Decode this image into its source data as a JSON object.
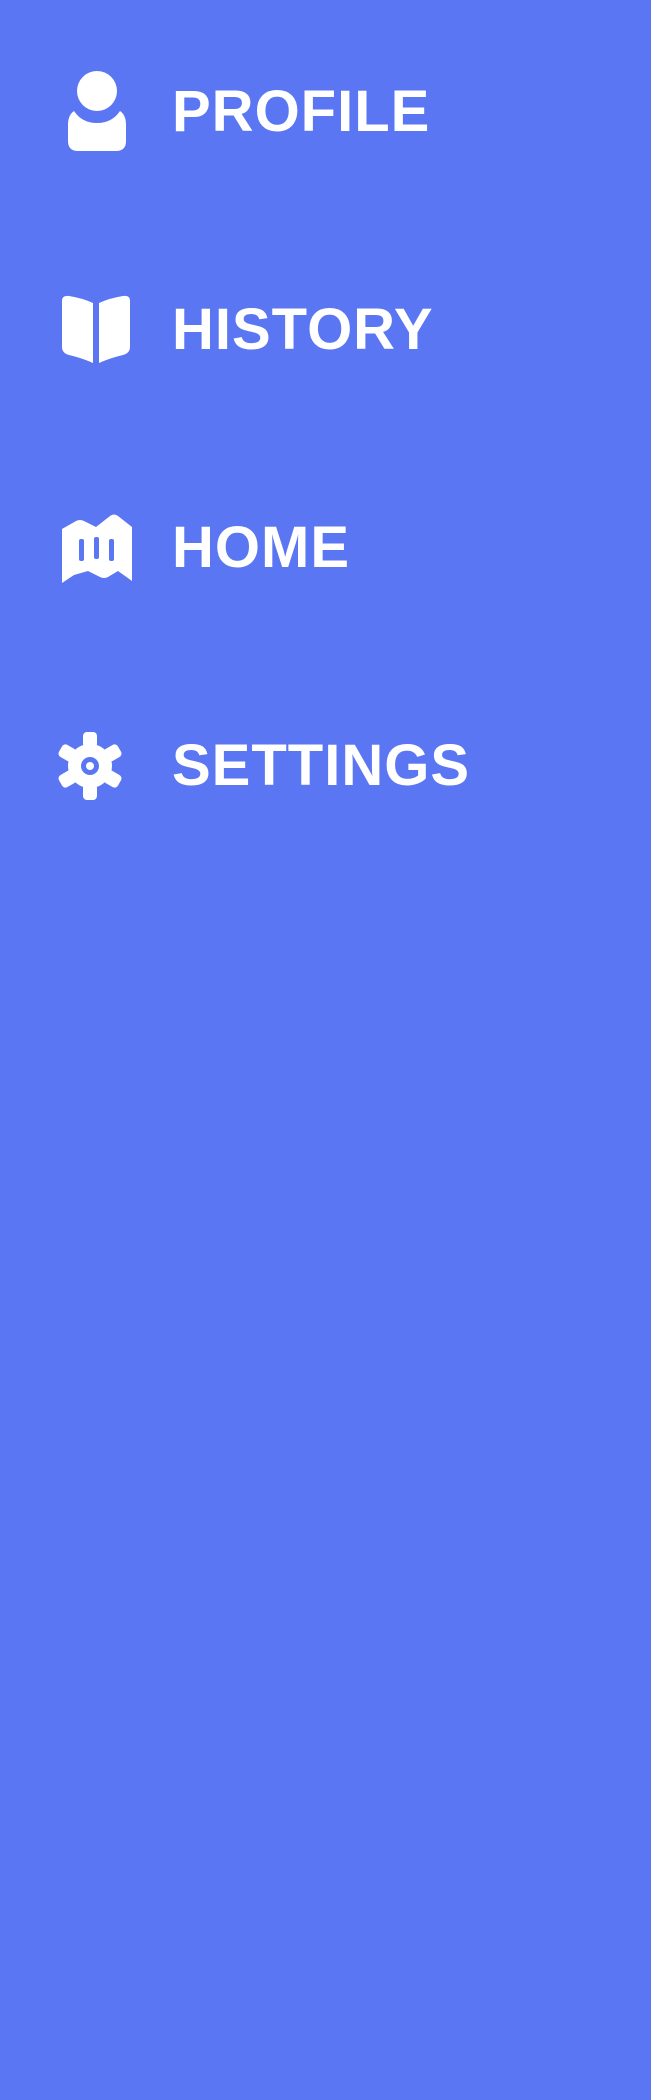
{
  "theme": {
    "background": "#5b76f3",
    "foreground": "#ffffff"
  },
  "nav": {
    "items": [
      {
        "id": "profile",
        "label": "PROFILE",
        "icon": "user-icon"
      },
      {
        "id": "history",
        "label": "HISTORY",
        "icon": "book-icon"
      },
      {
        "id": "home",
        "label": "HOME",
        "icon": "map-icon"
      },
      {
        "id": "settings",
        "label": "SETTINGS",
        "icon": "gear-icon"
      }
    ]
  }
}
